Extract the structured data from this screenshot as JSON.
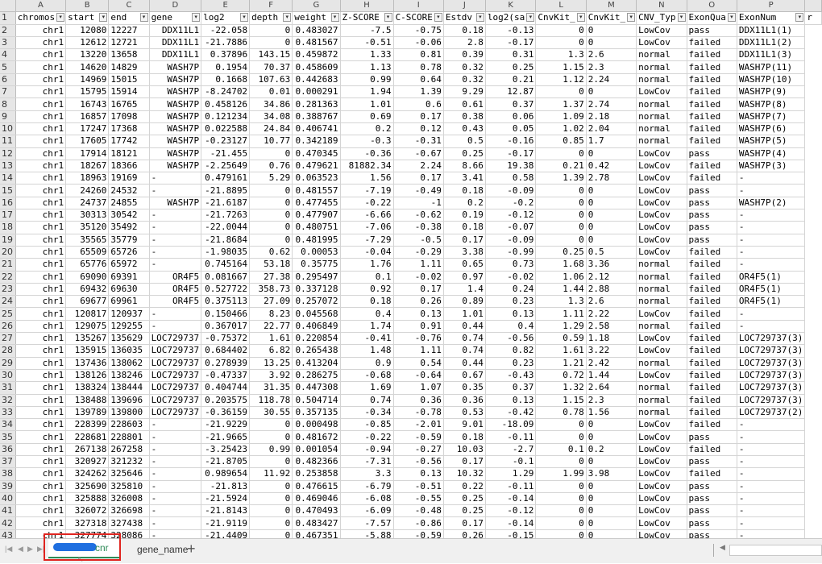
{
  "column_letters": [
    "A",
    "B",
    "C",
    "D",
    "E",
    "F",
    "G",
    "H",
    "I",
    "J",
    "K",
    "L",
    "M",
    "N",
    "O",
    "P"
  ],
  "headers": [
    "chromos",
    "start",
    "end",
    "gene",
    "log2",
    "depth",
    "weight",
    "Z-SCORE",
    "C-SCORE",
    "Estdv",
    "log2(sa",
    "CnvKit_",
    "CnvKit_",
    "CNV_Typ",
    "ExonQua",
    "ExonNum",
    "r"
  ],
  "header_row_num": "1",
  "rows": [
    [
      "2",
      "chr1",
      "12080",
      "12227",
      "DDX11L1",
      "-22.058",
      "0",
      "0.483027",
      "-7.5",
      "-0.75",
      "0.18",
      "-0.13",
      "0",
      "0",
      "LowCov",
      "pass",
      "DDX11L1(1)"
    ],
    [
      "3",
      "chr1",
      "12612",
      "12721",
      "DDX11L1",
      "-21.7886",
      "0",
      "0.481567",
      "-0.51",
      "-0.06",
      "2.8",
      "-0.17",
      "0",
      "0",
      "LowCov",
      "failed",
      "DDX11L1(2)"
    ],
    [
      "4",
      "chr1",
      "13220",
      "13658",
      "DDX11L1",
      "0.37896",
      "143.15",
      "0.459872",
      "1.33",
      "0.81",
      "0.39",
      "0.31",
      "1.3",
      "2.6",
      "normal",
      "failed",
      "DDX11L1(3)"
    ],
    [
      "5",
      "chr1",
      "14620",
      "14829",
      "WASH7P",
      "0.1954",
      "70.37",
      "0.458609",
      "1.13",
      "0.78",
      "0.32",
      "0.25",
      "1.15",
      "2.3",
      "normal",
      "failed",
      "WASH7P(11)"
    ],
    [
      "6",
      "chr1",
      "14969",
      "15015",
      "WASH7P",
      "0.1668",
      "107.63",
      "0.442683",
      "0.99",
      "0.64",
      "0.32",
      "0.21",
      "1.12",
      "2.24",
      "normal",
      "failed",
      "WASH7P(10)"
    ],
    [
      "7",
      "chr1",
      "15795",
      "15914",
      "WASH7P",
      "-8.24702",
      "0.01",
      "0.000291",
      "1.94",
      "1.39",
      "9.29",
      "12.87",
      "0",
      "0",
      "LowCov",
      "failed",
      "WASH7P(9)"
    ],
    [
      "8",
      "chr1",
      "16743",
      "16765",
      "WASH7P",
      "0.458126",
      "34.86",
      "0.281363",
      "1.01",
      "0.6",
      "0.61",
      "0.37",
      "1.37",
      "2.74",
      "normal",
      "failed",
      "WASH7P(8)"
    ],
    [
      "9",
      "chr1",
      "16857",
      "17098",
      "WASH7P",
      "0.121234",
      "34.08",
      "0.388767",
      "0.69",
      "0.17",
      "0.38",
      "0.06",
      "1.09",
      "2.18",
      "normal",
      "failed",
      "WASH7P(7)"
    ],
    [
      "10",
      "chr1",
      "17247",
      "17368",
      "WASH7P",
      "0.022588",
      "24.84",
      "0.406741",
      "0.2",
      "0.12",
      "0.43",
      "0.05",
      "1.02",
      "2.04",
      "normal",
      "failed",
      "WASH7P(6)"
    ],
    [
      "11",
      "chr1",
      "17605",
      "17742",
      "WASH7P",
      "-0.23127",
      "10.77",
      "0.342189",
      "-0.3",
      "-0.31",
      "0.5",
      "-0.16",
      "0.85",
      "1.7",
      "normal",
      "failed",
      "WASH7P(5)"
    ],
    [
      "12",
      "chr1",
      "17914",
      "18121",
      "WASH7P",
      "-21.455",
      "0",
      "0.470345",
      "-0.36",
      "-0.67",
      "0.25",
      "-0.17",
      "0",
      "0",
      "LowCov",
      "pass",
      "WASH7P(4)"
    ],
    [
      "13",
      "chr1",
      "18267",
      "18366",
      "WASH7P",
      "-2.25649",
      "0.76",
      "0.479621",
      "81882.34",
      "2.24",
      "8.66",
      "19.38",
      "0.21",
      "0.42",
      "LowCov",
      "failed",
      "WASH7P(3)"
    ],
    [
      "14",
      "chr1",
      "18963",
      "19169",
      "-",
      "0.479161",
      "5.29",
      "0.063523",
      "1.56",
      "0.17",
      "3.41",
      "0.58",
      "1.39",
      "2.78",
      "LowCov",
      "failed",
      "-"
    ],
    [
      "15",
      "chr1",
      "24260",
      "24532",
      "-",
      "-21.8895",
      "0",
      "0.481557",
      "-7.19",
      "-0.49",
      "0.18",
      "-0.09",
      "0",
      "0",
      "LowCov",
      "pass",
      "-"
    ],
    [
      "16",
      "chr1",
      "24737",
      "24855",
      "WASH7P",
      "-21.6187",
      "0",
      "0.477455",
      "-0.22",
      "-1",
      "0.2",
      "-0.2",
      "0",
      "0",
      "LowCov",
      "pass",
      "WASH7P(2)"
    ],
    [
      "17",
      "chr1",
      "30313",
      "30542",
      "-",
      "-21.7263",
      "0",
      "0.477907",
      "-6.66",
      "-0.62",
      "0.19",
      "-0.12",
      "0",
      "0",
      "LowCov",
      "pass",
      "-"
    ],
    [
      "18",
      "chr1",
      "35120",
      "35492",
      "-",
      "-22.0044",
      "0",
      "0.480751",
      "-7.06",
      "-0.38",
      "0.18",
      "-0.07",
      "0",
      "0",
      "LowCov",
      "pass",
      "-"
    ],
    [
      "19",
      "chr1",
      "35565",
      "35779",
      "-",
      "-21.8684",
      "0",
      "0.481995",
      "-7.29",
      "-0.5",
      "0.17",
      "-0.09",
      "0",
      "0",
      "LowCov",
      "pass",
      "-"
    ],
    [
      "20",
      "chr1",
      "65509",
      "65726",
      "-",
      "-1.98035",
      "0.62",
      "0.00053",
      "-0.04",
      "-0.29",
      "3.38",
      "-0.99",
      "0.25",
      "0.5",
      "LowCov",
      "failed",
      "-"
    ],
    [
      "21",
      "chr1",
      "65776",
      "65972",
      "-",
      "0.745164",
      "53.18",
      "0.35775",
      "1.76",
      "1.11",
      "0.65",
      "0.73",
      "1.68",
      "3.36",
      "normal",
      "failed",
      "-"
    ],
    [
      "22",
      "chr1",
      "69090",
      "69391",
      "OR4F5",
      "0.081667",
      "27.38",
      "0.295497",
      "0.1",
      "-0.02",
      "0.97",
      "-0.02",
      "1.06",
      "2.12",
      "normal",
      "failed",
      "OR4F5(1)"
    ],
    [
      "23",
      "chr1",
      "69432",
      "69630",
      "OR4F5",
      "0.527722",
      "358.73",
      "0.337128",
      "0.92",
      "0.17",
      "1.4",
      "0.24",
      "1.44",
      "2.88",
      "normal",
      "failed",
      "OR4F5(1)"
    ],
    [
      "24",
      "chr1",
      "69677",
      "69961",
      "OR4F5",
      "0.375113",
      "27.09",
      "0.257072",
      "0.18",
      "0.26",
      "0.89",
      "0.23",
      "1.3",
      "2.6",
      "normal",
      "failed",
      "OR4F5(1)"
    ],
    [
      "25",
      "chr1",
      "120817",
      "120937",
      "-",
      "0.150466",
      "8.23",
      "0.045568",
      "0.4",
      "0.13",
      "1.01",
      "0.13",
      "1.11",
      "2.22",
      "LowCov",
      "failed",
      "-"
    ],
    [
      "26",
      "chr1",
      "129075",
      "129255",
      "-",
      "0.367017",
      "22.77",
      "0.406849",
      "1.74",
      "0.91",
      "0.44",
      "0.4",
      "1.29",
      "2.58",
      "normal",
      "failed",
      "-"
    ],
    [
      "27",
      "chr1",
      "135267",
      "135629",
      "LOC729737",
      "-0.75372",
      "1.61",
      "0.220854",
      "-0.41",
      "-0.76",
      "0.74",
      "-0.56",
      "0.59",
      "1.18",
      "LowCov",
      "failed",
      "LOC729737(3)"
    ],
    [
      "28",
      "chr1",
      "135915",
      "136035",
      "LOC729737",
      "0.684402",
      "6.82",
      "0.265438",
      "1.48",
      "1.11",
      "0.74",
      "0.82",
      "1.61",
      "3.22",
      "LowCov",
      "failed",
      "LOC729737(3)"
    ],
    [
      "29",
      "chr1",
      "137436",
      "138062",
      "LOC729737",
      "0.278939",
      "13.25",
      "0.413204",
      "0.9",
      "0.54",
      "0.44",
      "0.23",
      "1.21",
      "2.42",
      "normal",
      "failed",
      "LOC729737(3)"
    ],
    [
      "30",
      "chr1",
      "138126",
      "138246",
      "LOC729737",
      "-0.47337",
      "3.92",
      "0.286275",
      "-0.68",
      "-0.64",
      "0.67",
      "-0.43",
      "0.72",
      "1.44",
      "LowCov",
      "failed",
      "LOC729737(3)"
    ],
    [
      "31",
      "chr1",
      "138324",
      "138444",
      "LOC729737",
      "0.404744",
      "31.35",
      "0.447308",
      "1.69",
      "1.07",
      "0.35",
      "0.37",
      "1.32",
      "2.64",
      "normal",
      "failed",
      "LOC729737(3)"
    ],
    [
      "32",
      "chr1",
      "138488",
      "139696",
      "LOC729737",
      "0.203575",
      "118.78",
      "0.504714",
      "0.74",
      "0.36",
      "0.36",
      "0.13",
      "1.15",
      "2.3",
      "normal",
      "failed",
      "LOC729737(3)"
    ],
    [
      "33",
      "chr1",
      "139789",
      "139800",
      "LOC729737",
      "-0.36159",
      "30.55",
      "0.357135",
      "-0.34",
      "-0.78",
      "0.53",
      "-0.42",
      "0.78",
      "1.56",
      "normal",
      "failed",
      "LOC729737(2)"
    ],
    [
      "34",
      "chr1",
      "228399",
      "228603",
      "-",
      "-21.9229",
      "0",
      "0.000498",
      "-0.85",
      "-2.01",
      "9.01",
      "-18.09",
      "0",
      "0",
      "LowCov",
      "failed",
      "-"
    ],
    [
      "35",
      "chr1",
      "228681",
      "228801",
      "-",
      "-21.9665",
      "0",
      "0.481672",
      "-0.22",
      "-0.59",
      "0.18",
      "-0.11",
      "0",
      "0",
      "LowCov",
      "pass",
      "-"
    ],
    [
      "36",
      "chr1",
      "267138",
      "267258",
      "-",
      "-3.25423",
      "0.99",
      "0.001054",
      "-0.94",
      "-0.27",
      "10.03",
      "-2.7",
      "0.1",
      "0.2",
      "LowCov",
      "failed",
      "-"
    ],
    [
      "37",
      "chr1",
      "320927",
      "321232",
      "-",
      "-21.8705",
      "0",
      "0.482366",
      "-7.31",
      "-0.56",
      "0.17",
      "-0.1",
      "0",
      "0",
      "LowCov",
      "pass",
      "-"
    ],
    [
      "38",
      "chr1",
      "324262",
      "325646",
      "-",
      "0.989654",
      "11.92",
      "0.253858",
      "3.3",
      "0.13",
      "10.32",
      "1.29",
      "1.99",
      "3.98",
      "LowCov",
      "failed",
      "-"
    ],
    [
      "39",
      "chr1",
      "325690",
      "325810",
      "-",
      "-21.813",
      "0",
      "0.476615",
      "-6.79",
      "-0.51",
      "0.22",
      "-0.11",
      "0",
      "0",
      "LowCov",
      "pass",
      "-"
    ],
    [
      "40",
      "chr1",
      "325888",
      "326008",
      "-",
      "-21.5924",
      "0",
      "0.469046",
      "-6.08",
      "-0.55",
      "0.25",
      "-0.14",
      "0",
      "0",
      "LowCov",
      "pass",
      "-"
    ],
    [
      "41",
      "chr1",
      "326072",
      "326698",
      "-",
      "-21.8143",
      "0",
      "0.470493",
      "-6.09",
      "-0.48",
      "0.25",
      "-0.12",
      "0",
      "0",
      "LowCov",
      "pass",
      "-"
    ],
    [
      "42",
      "chr1",
      "327318",
      "327438",
      "-",
      "-21.9119",
      "0",
      "0.483427",
      "-7.57",
      "-0.86",
      "0.17",
      "-0.14",
      "0",
      "0",
      "LowCov",
      "pass",
      "-"
    ],
    [
      "43",
      "chr1",
      "327774",
      "328086",
      "-",
      "-21.4409",
      "0",
      "0.467351",
      "-5.88",
      "-0.59",
      "0.26",
      "-0.15",
      "0",
      "0",
      "LowCov",
      "pass",
      "-"
    ]
  ],
  "sheet_tabs": {
    "active_label": "cnr",
    "active_sub": "↖",
    "second_label": "gene_name",
    "add_label": "+"
  },
  "nav_buttons": [
    "|◀",
    "◀",
    "▶",
    "▶|"
  ],
  "colors": {
    "active_tab_text": "#2e8b57",
    "highlight_box": "#e0241f",
    "redacted_blue": "#1f6fe0"
  }
}
